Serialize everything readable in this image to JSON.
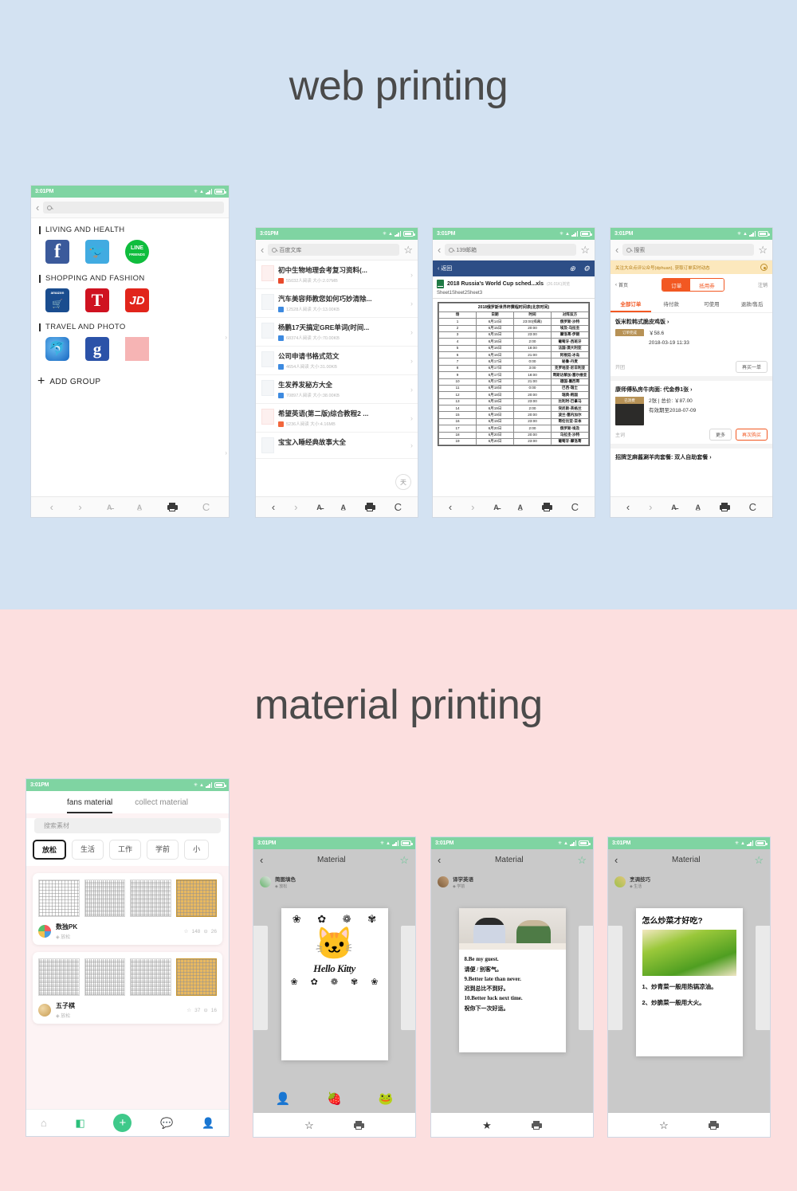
{
  "sections": {
    "web": {
      "title": "web printing",
      "bg": "#d3e2f2"
    },
    "material": {
      "title": "material printing",
      "bg": "#fcdfdf"
    }
  },
  "status_bar": {
    "time": "3:01PM",
    "icons": [
      "bluetooth-icon",
      "wifi-icon",
      "signal-icon",
      "battery-icon"
    ]
  },
  "browser_toolbar": {
    "back": "‹",
    "forward": "›",
    "font_small": "A",
    "font_large": "A",
    "print": "printer-icon",
    "refresh": "C"
  },
  "phone1": {
    "search_placeholder": "",
    "groups": [
      {
        "label": "LIVING AND HEALTH",
        "apps": [
          "facebook",
          "twitter",
          "line-friends"
        ]
      },
      {
        "label": "SHOPPING AND FASHION",
        "apps": [
          "amazon",
          "tmall",
          "jd"
        ]
      },
      {
        "label": "TRAVEL AND PHOTO",
        "apps": [
          "sogou",
          "google",
          "photo"
        ]
      }
    ],
    "app_labels": {
      "facebook": "f",
      "twitter": "",
      "line1": "LINE",
      "line2": "FRIENDS",
      "amazon": "amazon",
      "tmall": "T",
      "jd": "JD",
      "google": "g"
    },
    "add_group": "ADD GROUP",
    "add_plus": "+"
  },
  "phone2": {
    "search_value": "百度文库",
    "star": "star-icon",
    "docs": [
      {
        "title": "初中生物地理会考复习资料(...",
        "stats": "55032人阅读  大小:2.07MB",
        "tag": "red"
      },
      {
        "title": "汽车美容师教您如何巧妙清除...",
        "stats": "12528人阅读  大小:13.00KB",
        "tag": "blue"
      },
      {
        "title": "杨鹏17天搞定GRE单词(时间...",
        "stats": "68374人阅读  大小:70.00KB",
        "tag": "blue"
      },
      {
        "title": "公司申请书格式范文",
        "stats": "4654人阅读  大小:31.00KB",
        "tag": "blue"
      },
      {
        "title": "生发养发秘方大全",
        "stats": "70897人阅读  大小:38.00KB",
        "tag": "blue"
      },
      {
        "title": "希望英语(第二版)综合教程2 ...",
        "stats": "5236人阅读  大小:4.16MB",
        "tag": "orange"
      },
      {
        "title": "宝宝入睡经典故事大全",
        "stats": "",
        "tag": "blue"
      }
    ],
    "fab": "天"
  },
  "phone3": {
    "search_value": "139邮箱",
    "back_label": "返回",
    "file_name": "2018 Russia's World Cup sched...xls",
    "file_size": "(26.01K)浏览",
    "sheet_tabs": "Sheet1Sheet2Sheet3",
    "table": {
      "caption": "2018俄罗斯世界杯赛程时间表(北京时间)",
      "headers": [
        "场",
        "日期",
        "时间",
        "对阵双方"
      ],
      "rows": [
        [
          "1",
          "6月14日",
          "23:00(揭幕)",
          "俄罗斯-沙特"
        ],
        [
          "2",
          "6月15日",
          "20:00",
          "埃及-乌拉圭"
        ],
        [
          "3",
          "6月15日",
          "23:00",
          "摩洛哥-伊朗"
        ],
        [
          "4",
          "6月16日",
          "2:00",
          "葡萄牙-西班牙"
        ],
        [
          "5",
          "6月16日",
          "18:00",
          "法国-澳大利亚"
        ],
        [
          "6",
          "6月16日",
          "21:00",
          "阿根廷-冰岛"
        ],
        [
          "7",
          "6月17日",
          "0:00",
          "秘鲁-丹麦"
        ],
        [
          "8",
          "6月17日",
          "3:00",
          "克罗地亚-尼日利亚"
        ],
        [
          "9",
          "6月17日",
          "18:00",
          "哥斯达黎加-塞尔维亚"
        ],
        [
          "10",
          "6月17日",
          "21:00",
          "德国-墨西哥"
        ],
        [
          "11",
          "6月18日",
          "0:00",
          "巴西-瑞士"
        ],
        [
          "12",
          "6月18日",
          "20:00",
          "瑞典-韩国"
        ],
        [
          "13",
          "6月18日",
          "23:00",
          "比利时-巴拿马"
        ],
        [
          "14",
          "6月19日",
          "2:00",
          "突尼斯-英格兰"
        ],
        [
          "15",
          "6月19日",
          "20:00",
          "波兰-塞内加尔"
        ],
        [
          "16",
          "6月19日",
          "23:00",
          "哥伦比亚-日本"
        ],
        [
          "17",
          "6月20日",
          "2:00",
          "俄罗斯-埃及"
        ],
        [
          "18",
          "6月20日",
          "20:00",
          "乌拉圭-沙特"
        ],
        [
          "19",
          "6月20日",
          "23:00",
          "葡萄牙-摩洛哥"
        ]
      ]
    }
  },
  "phone4": {
    "search_placeholder": "搜索",
    "promo": "关注大众点评公众号(dphuan), 获取订单实时动态",
    "home_label": "首页",
    "segment": {
      "left": "订单",
      "right": "抵用券",
      "right_meta": "注销"
    },
    "tabs": [
      "全部订单",
      "待付款",
      "可使用",
      "退款/售后"
    ],
    "orders": [
      {
        "title": "饭米粒韩式脆皮鸡饭 ›",
        "badge": "订单完成",
        "price": "￥58.6",
        "date": "2018-03-19 11:33",
        "left": "开团",
        "buttons": [
          "再买一单"
        ]
      },
      {
        "title": "康师傅私房牛肉面: 代金券1张 ›",
        "badge": "已消费",
        "price": "2张 | 总价: ￥87.00",
        "date": "有效期至2018-07-09",
        "left": "主词",
        "buttons": [
          "更多",
          "再次购买"
        ]
      }
    ],
    "last_row": "招牌芝麻酱涮羊肉套餐: 双人自助套餐 ›"
  },
  "phone5": {
    "tabs": [
      {
        "label": "fans material",
        "active": true
      },
      {
        "label": "collect material",
        "active": false
      }
    ],
    "search_placeholder": "搜索素材",
    "chips": [
      {
        "label": "放松",
        "active": true
      },
      {
        "label": "生活",
        "active": false
      },
      {
        "label": "工作",
        "active": false
      },
      {
        "label": "学前",
        "active": false
      },
      {
        "label": "小",
        "active": false
      }
    ],
    "cards": [
      {
        "name": "数独PK",
        "tag": "放松",
        "stat_star": "148",
        "stat_print": "26",
        "thumb_label": "SUDOKU"
      },
      {
        "name": "五子棋",
        "tag": "放松",
        "stat_star": "37",
        "stat_print": "16",
        "thumb_label": ""
      }
    ],
    "navbar": [
      "home-icon",
      "grid-icon",
      "add-icon",
      "chat-icon",
      "profile-icon"
    ]
  },
  "material_detail": [
    {
      "title": "Material",
      "author": "简图填色",
      "author_tag": "放松",
      "slide_type": "kitty",
      "slide_text": "Hello Kitty",
      "footer": [
        "star-outline-icon",
        "printer-icon"
      ]
    },
    {
      "title": "Material",
      "author": "译学英语",
      "author_tag": "学前",
      "slide_type": "english",
      "lines": [
        "8.Be my guest.",
        "请便 / 别客气。",
        "9.Better late than never.",
        "迟到总比不到好。",
        "10.Better luck next time.",
        "祝你下一次好运。"
      ],
      "footer": [
        "star-filled-icon",
        "printer-icon"
      ]
    },
    {
      "title": "Material",
      "author": "烹调技巧",
      "author_tag": "生活",
      "slide_type": "cooking",
      "heading": "怎么炒菜才好吃?",
      "lines": [
        "1、炒青菜一般用热锅凉油。",
        "2、炒脆菜一般用大火。"
      ],
      "footer": [
        "star-outline-icon",
        "printer-icon"
      ]
    }
  ],
  "colors": {
    "status_green": "#7fd4a2",
    "accent_orange": "#f25822",
    "blue_header": "#2d4e86",
    "section_blue": "#d3e2f2",
    "section_pink": "#fcdfdf"
  }
}
